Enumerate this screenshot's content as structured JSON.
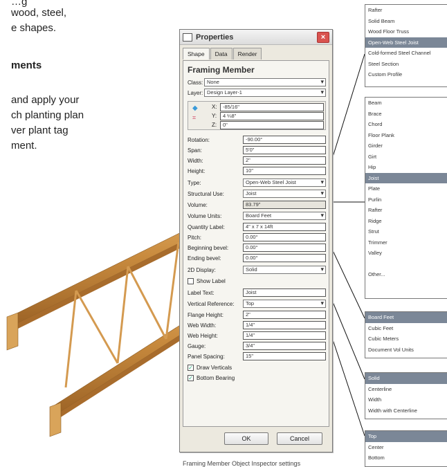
{
  "page_text": {
    "line1": "…g",
    "line2": "wood, steel,",
    "line3": "e shapes.",
    "heading": "ments",
    "para1": "and apply your",
    "para2": "ch planting plan",
    "para3": "ver plant tag",
    "para4": "ment."
  },
  "window": {
    "title": "Properties",
    "close_label": "×",
    "tabs": [
      "Shape",
      "Data",
      "Render"
    ],
    "section_title": "Framing Member",
    "class_label": "Class:",
    "class_value": "None",
    "layer_label": "Layer:",
    "layer_value": "Design Layer-1",
    "x_label": "X:",
    "x_value": "-85/16\"",
    "y_label": "Y:",
    "y_value": "4 ¼8\"",
    "z_label": "Z:",
    "z_value": "0\"",
    "rotation_label": "Rotation:",
    "rotation_value": "-90.00°",
    "span_label": "Span:",
    "span_value": "5'0\"",
    "width_label": "Width:",
    "width_value": "2\"",
    "height_label": "Height:",
    "height_value": "10\"",
    "type_label": "Type:",
    "type_value": "Open-Web Steel Joist",
    "structural_label": "Structural Use:",
    "structural_value": "Joist",
    "volume_label": "Volume:",
    "volume_value": "83.79\"",
    "volume_units_label": "Volume Units:",
    "volume_units_value": "Board Feet",
    "quantity_label": "Quantity Label:",
    "quantity_value": "4\" x 7 x 14ft",
    "pitch_label": "Pitch:",
    "pitch_value": "0.00°",
    "begin_bevel_label": "Beginning bevel:",
    "begin_bevel_value": "0.00°",
    "end_bevel_label": "Ending bevel:",
    "end_bevel_value": "0.00°",
    "display_label": "2D Display:",
    "display_value": "Solid",
    "show_label_text": "Show Label",
    "label_text_label": "Label Text:",
    "label_text_value": "Joist",
    "vertical_ref_label": "Vertical Reference:",
    "vertical_ref_value": "Top",
    "flange_label": "Flange Height:",
    "flange_value": "2\"",
    "web_width_label": "Web Width:",
    "web_width_value": "1/4\"",
    "web_height_label": "Web Height:",
    "web_height_value": "1/4\"",
    "gauge_label": "Gauge:",
    "gauge_value": "3/4\"",
    "panel_spacing_label": "Panel Spacing:",
    "panel_spacing_value": "15\"",
    "draw_verticals_label": "Draw Verticals",
    "bottom_bearing_label": "Bottom Bearing",
    "ok_label": "OK",
    "cancel_label": "Cancel"
  },
  "lists": {
    "type_options": [
      "Rafter",
      "Solid Beam",
      "Wood Floor Truss",
      "Open-Web Steel Joist",
      "Cold-formed Steel Channel",
      "Steel Section",
      "Custom Profile"
    ],
    "type_selected": 3,
    "use_options": [
      "Beam",
      "Brace",
      "Chord",
      "Floor Plank",
      "Girder",
      "Girt",
      "Hip",
      "Joist",
      "Plate",
      "Purlin",
      "Rafter",
      "Ridge",
      "Strut",
      "Trimmer",
      "Valley",
      "",
      "Other..."
    ],
    "use_selected": 7,
    "units_options": [
      "Board Feet",
      "Cubic Feet",
      "Cubic Meters",
      "Document Vol Units"
    ],
    "units_selected": 0,
    "display_options": [
      "Solid",
      "Centerline",
      "Width",
      "Width with Centerline"
    ],
    "display_selected": 0,
    "vref_options": [
      "Top",
      "Center",
      "Bottom"
    ],
    "vref_selected": 0
  },
  "caption": "Framing Member Object Inspector settings",
  "colors": {
    "selected": "#7b8797",
    "beam": "#c98b3e",
    "close": "#d9534f"
  }
}
